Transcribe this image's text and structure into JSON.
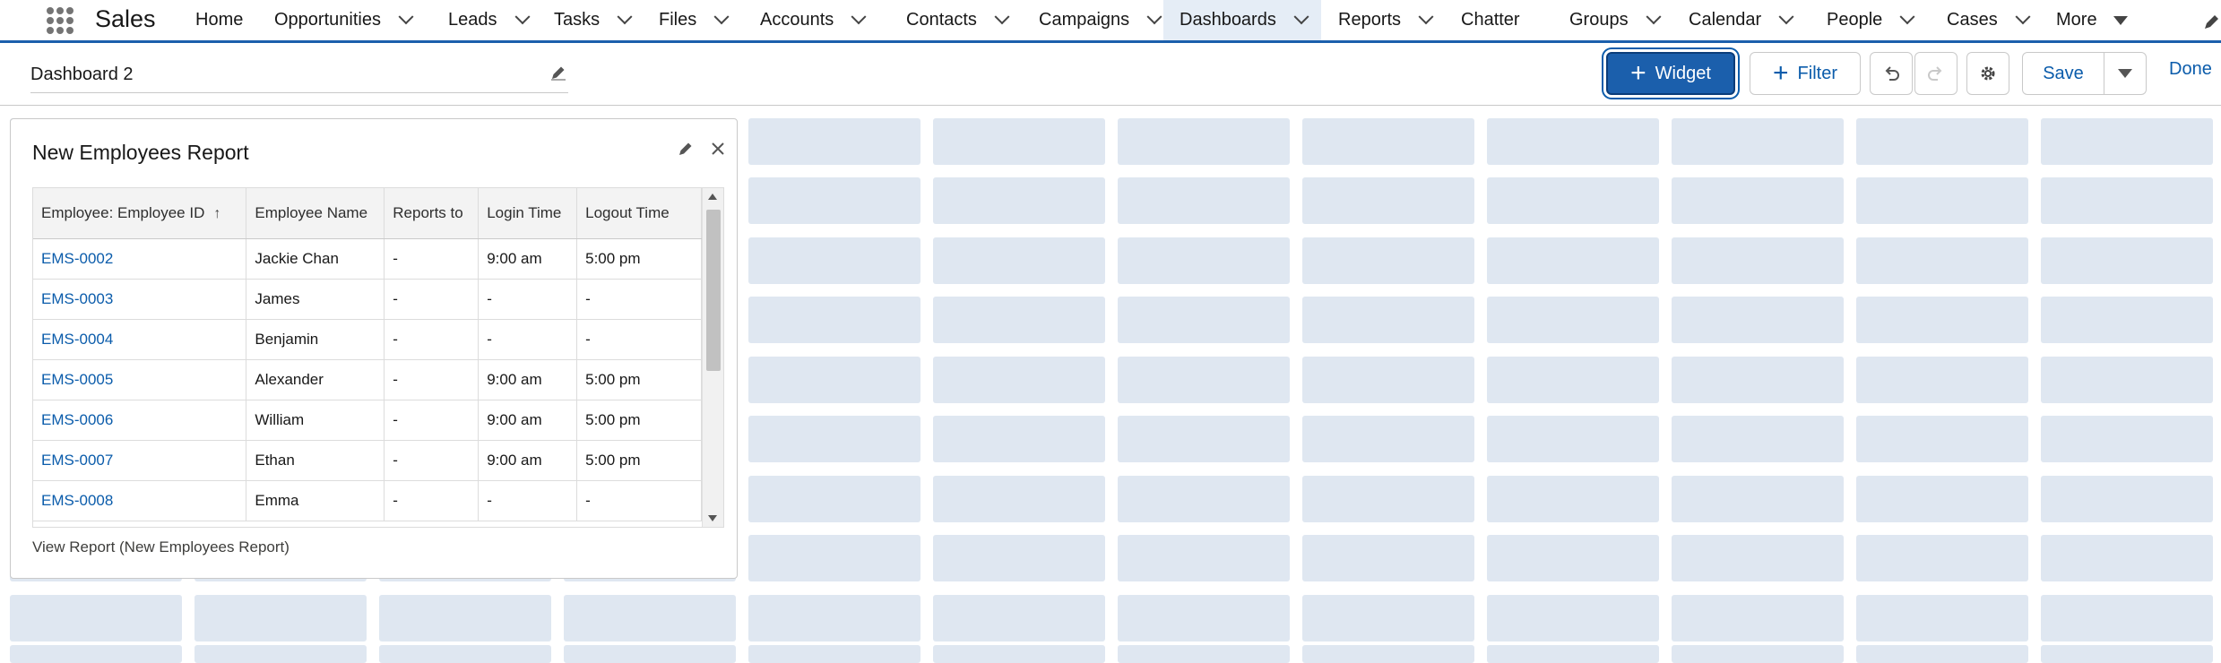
{
  "nav": {
    "app_name": "Sales",
    "items": [
      {
        "label": "Home",
        "has_menu": false
      },
      {
        "label": "Opportunities",
        "has_menu": true
      },
      {
        "label": "Leads",
        "has_menu": true
      },
      {
        "label": "Tasks",
        "has_menu": true
      },
      {
        "label": "Files",
        "has_menu": true
      },
      {
        "label": "Accounts",
        "has_menu": true
      },
      {
        "label": "Contacts",
        "has_menu": true
      },
      {
        "label": "Campaigns",
        "has_menu": true
      },
      {
        "label": "Dashboards",
        "has_menu": true,
        "active": true
      },
      {
        "label": "Reports",
        "has_menu": true
      },
      {
        "label": "Chatter",
        "has_menu": false
      },
      {
        "label": "Groups",
        "has_menu": true
      },
      {
        "label": "Calendar",
        "has_menu": true
      },
      {
        "label": "People",
        "has_menu": true
      },
      {
        "label": "Cases",
        "has_menu": true
      },
      {
        "label": "More",
        "has_menu": true
      }
    ]
  },
  "header": {
    "dashboard_title": "Dashboard 2",
    "widget_button": "Widget",
    "filter_button": "Filter",
    "save_button": "Save",
    "done_link": "Done"
  },
  "widget": {
    "title": "New Employees Report",
    "columns": [
      "Employee: Employee ID",
      "Employee Name",
      "Reports to",
      "Login Time",
      "Logout Time"
    ],
    "rows": [
      [
        "EMS-0002",
        "Jackie Chan",
        "-",
        "9:00 am",
        "5:00 pm"
      ],
      [
        "EMS-0003",
        "James",
        "-",
        "-",
        "-"
      ],
      [
        "EMS-0004",
        "Benjamin",
        "-",
        "-",
        "-"
      ],
      [
        "EMS-0005",
        "Alexander",
        "-",
        "9:00 am",
        "5:00 pm"
      ],
      [
        "EMS-0006",
        "William",
        "-",
        "9:00 am",
        "5:00 pm"
      ],
      [
        "EMS-0007",
        "Ethan",
        "-",
        "9:00 am",
        "5:00 pm"
      ],
      [
        "EMS-0008",
        "Emma",
        "-",
        "-",
        "-"
      ]
    ],
    "view_report_link": "View Report (New Employees Report)"
  },
  "colors": {
    "brand": "#1b5fac",
    "link": "#0b5cab",
    "grid_cell": "#dfe7f1"
  }
}
